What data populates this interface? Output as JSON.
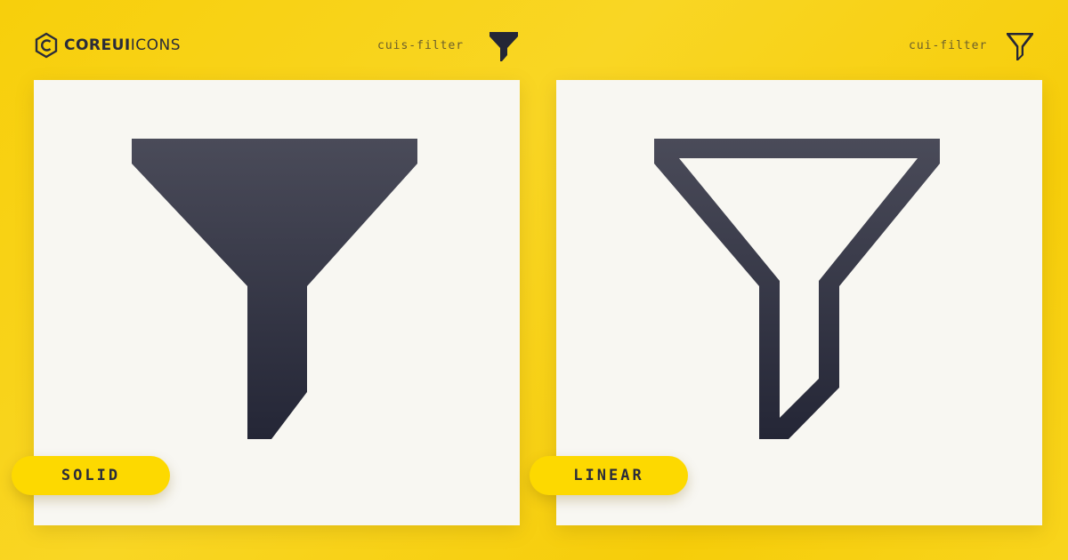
{
  "brand": {
    "logo_bold": "COREUI",
    "logo_light": "ICONS",
    "logo_icon": "coreui-hexagon-icon"
  },
  "variants": [
    {
      "label": "SOLID",
      "icon_name": "cuis-filter",
      "icon": "filter-solid-icon"
    },
    {
      "label": "LINEAR",
      "icon_name": "cui-filter",
      "icon": "filter-linear-icon"
    }
  ],
  "colors": {
    "background": "#f8d20f",
    "card": "#f8f7f2",
    "pill": "#fdd900",
    "icon_top": "#4a4b59",
    "icon_bottom": "#242636"
  }
}
